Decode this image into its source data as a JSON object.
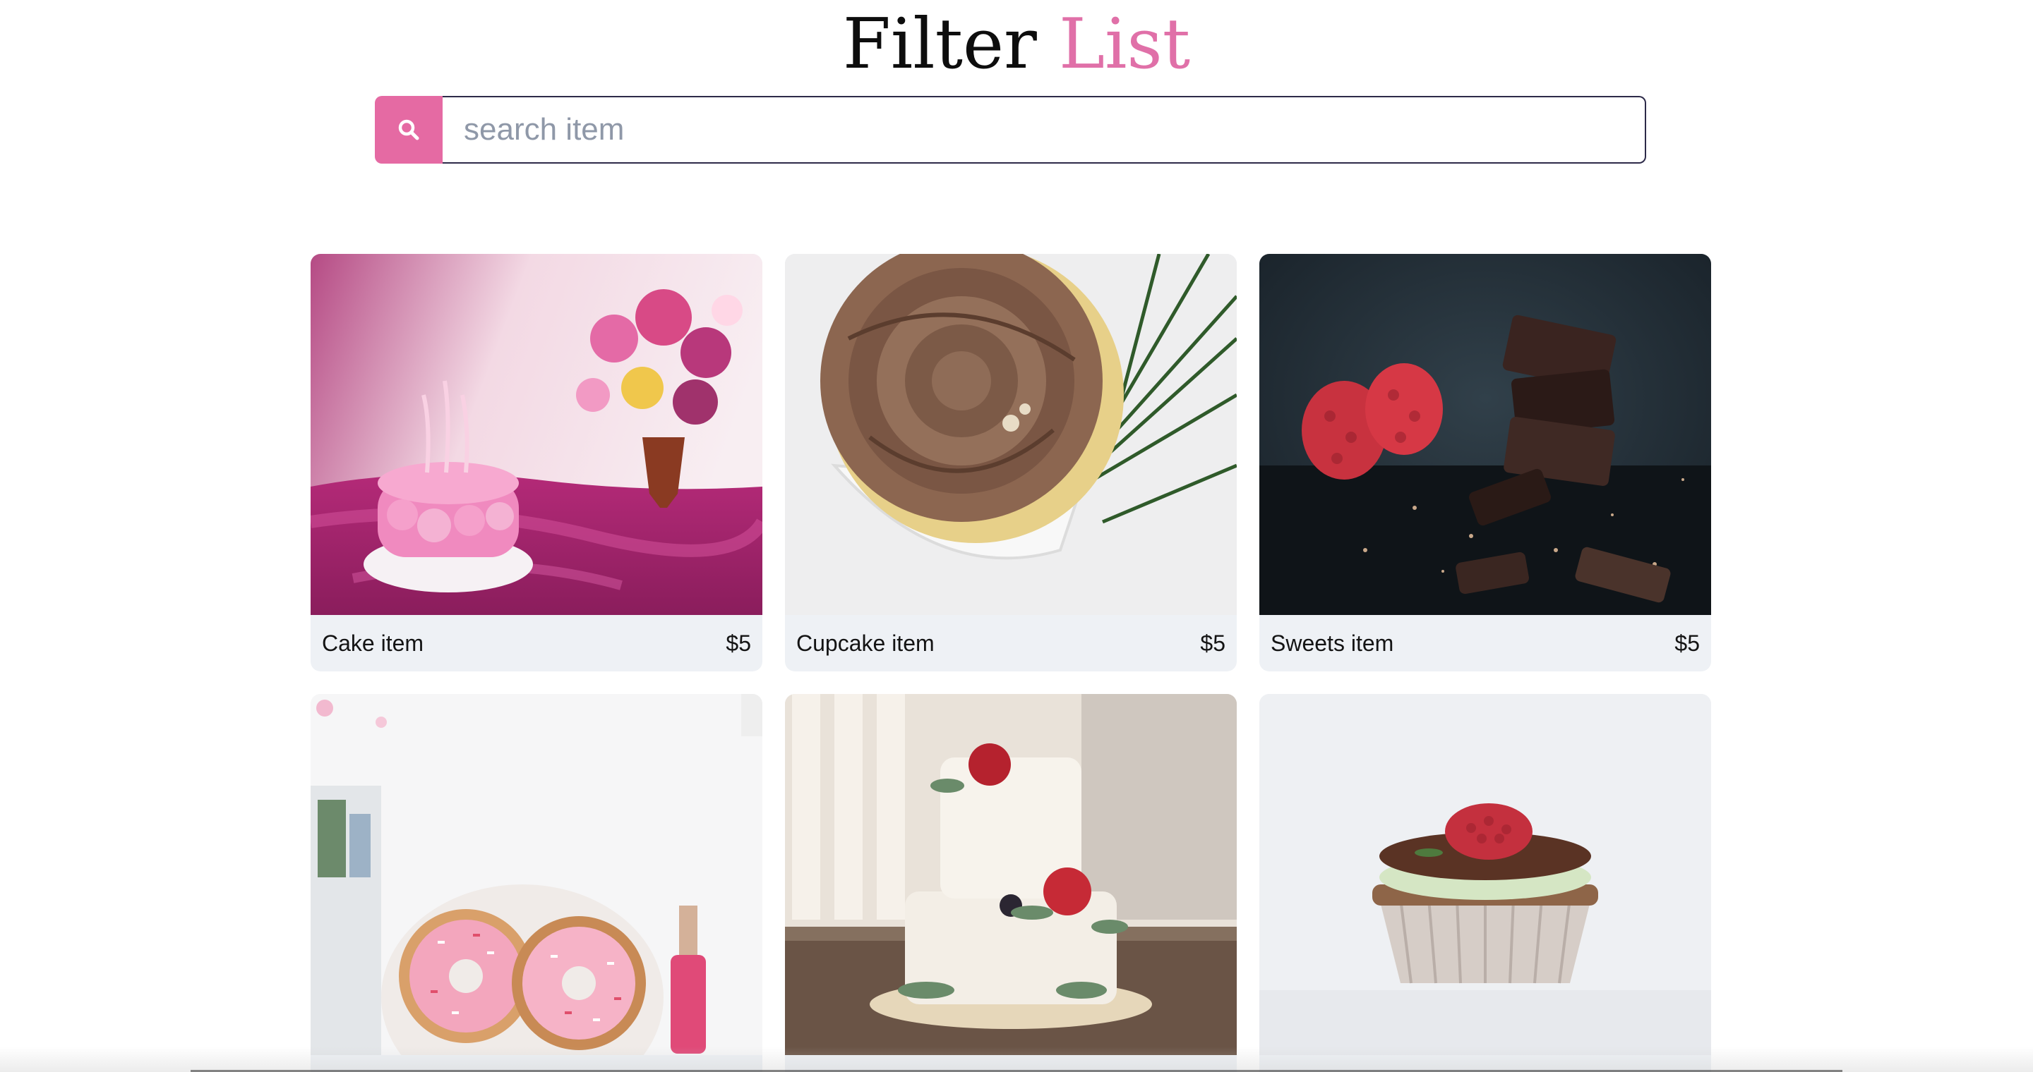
{
  "header": {
    "title_main": "Filter",
    "title_accent": "List"
  },
  "search": {
    "placeholder": "search item",
    "value": ""
  },
  "items": [
    {
      "name": "Cake item",
      "price": "$5",
      "image": "pink-rose-cake-photo"
    },
    {
      "name": "Cupcake item",
      "price": "$5",
      "image": "chocolate-frosting-cupcake-photo"
    },
    {
      "name": "Sweets item",
      "price": "$5",
      "image": "chocolate-raspberry-sweets-photo"
    },
    {
      "name": "",
      "price": "",
      "image": "pink-doughnuts-photo"
    },
    {
      "name": "",
      "price": "",
      "image": "white-tiered-cake-photo"
    },
    {
      "name": "",
      "price": "",
      "image": "raspberry-cupcake-photo"
    }
  ],
  "colors": {
    "accent": "#e56aa3",
    "title_accent": "#e070a8",
    "card_footer_bg": "#eef1f5",
    "input_border": "#2d2a49"
  }
}
